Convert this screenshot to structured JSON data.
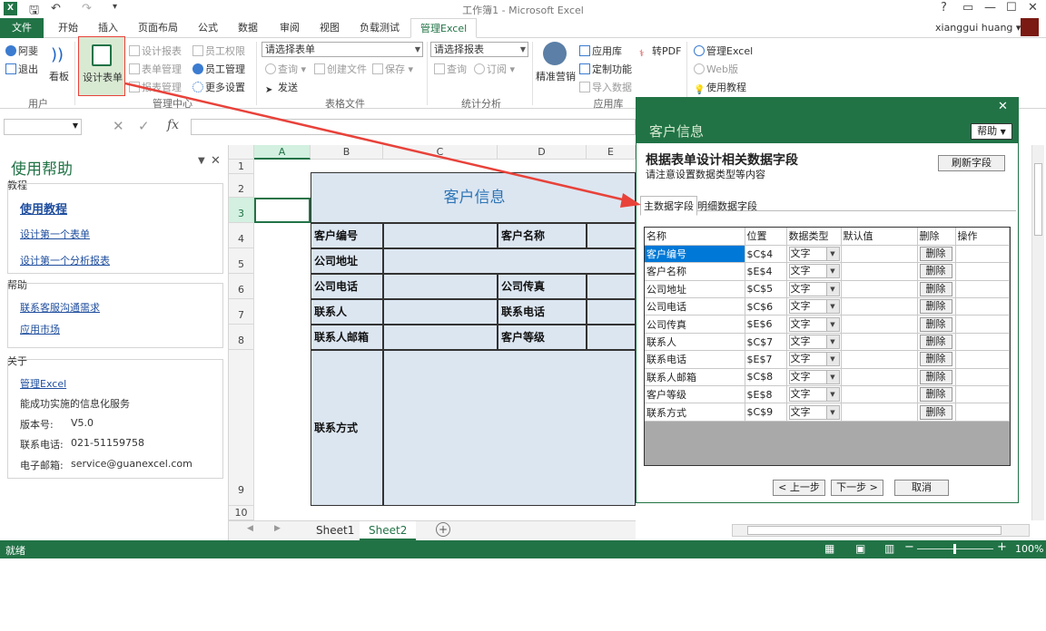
{
  "app": {
    "window_title": "工作簿1 - Microsoft Excel",
    "user_name": "xianggui huang"
  },
  "tabs": [
    "文件",
    "开始",
    "插入",
    "页面布局",
    "公式",
    "数据",
    "审阅",
    "视图",
    "负载测试",
    "管理Excel"
  ],
  "ribbon": {
    "user": {
      "login": "阿斐",
      "logout": "退出",
      "board": "看板",
      "group_label": "用户"
    },
    "design": {
      "design_form": "设计表单",
      "design_report": "设计报表",
      "form_manage": "表单管理",
      "report_manage": "报表管理",
      "employee_perm": "员工权限",
      "employee_manage": "员工管理",
      "more_settings": "更多设置",
      "group_label": "管理中心"
    },
    "form_file": {
      "select_form": "请选择表单",
      "query": "查询",
      "create_file": "创建文件",
      "save": "保存",
      "send": "发送",
      "group_label": "表格文件"
    },
    "stats": {
      "select_report": "请选择报表",
      "query": "查询",
      "subscribe": "订阅",
      "group_label": "统计分析"
    },
    "apps": {
      "precision": "精准营销",
      "app_store": "应用库",
      "custom": "定制功能",
      "import": "导入数据",
      "to_pdf": "转PDF",
      "group_label": "应用库"
    },
    "manage_excel": {
      "manage": "管理Excel",
      "web": "Web版",
      "tutorial": "使用教程"
    }
  },
  "formula_bar": {
    "fx": "fx"
  },
  "help_pane": {
    "title": "使用帮助",
    "sections": [
      {
        "label": "教程",
        "items": [
          {
            "text": "使用教程",
            "kind": "big-link"
          },
          {
            "text": "设计第一个表单",
            "kind": "link"
          },
          {
            "text": "设计第一个分析报表",
            "kind": "link"
          }
        ]
      },
      {
        "label": "帮助",
        "items": [
          {
            "text": "联系客服沟通需求",
            "kind": "link"
          },
          {
            "text": "应用市场",
            "kind": "link"
          }
        ]
      },
      {
        "label": "关于",
        "items": [
          {
            "text": "管理Excel",
            "kind": "link"
          },
          {
            "text": "能成功实施的信息化服务",
            "kind": "text"
          },
          {
            "label": "版本号:",
            "value": "V5.0",
            "kind": "pair"
          },
          {
            "label": "联系电话:",
            "value": "021-51159758",
            "kind": "pair"
          },
          {
            "label": "电子邮箱:",
            "value": "service@guanexcel.com",
            "kind": "pair"
          }
        ]
      }
    ]
  },
  "sheet": {
    "columns": [
      "A",
      "B",
      "C",
      "D",
      "E"
    ],
    "rows": [
      "1",
      "2",
      "3",
      "4",
      "5",
      "6",
      "7",
      "8",
      "9",
      "10"
    ],
    "form_title": "客户信息",
    "labels": {
      "customer_no": "客户编号",
      "customer_name": "客户名称",
      "address": "公司地址",
      "phone": "公司电话",
      "fax": "公司传真",
      "contact": "联系人",
      "contact_phone": "联系电话",
      "contact_email": "联系人邮箱",
      "level": "客户等级",
      "contact_method": "联系方式"
    },
    "tabs": [
      "Sheet1",
      "Sheet2"
    ],
    "active_tab": "Sheet2"
  },
  "status": {
    "text": "就绪",
    "zoom": "100%"
  },
  "dialog": {
    "title": "客户信息",
    "help_label": "帮助",
    "heading": "根据表单设计相关数据字段",
    "subheading": "请注意设置数据类型等内容",
    "refresh_button": "刷新字段",
    "tabs": [
      "主数据字段",
      "明细数据字段"
    ],
    "columns": [
      "名称",
      "位置",
      "数据类型",
      "默认值",
      "删除",
      "操作"
    ],
    "rows": [
      {
        "name": "客户编号",
        "pos": "$C$4",
        "type": "文字",
        "del": "删除"
      },
      {
        "name": "客户名称",
        "pos": "$E$4",
        "type": "文字",
        "del": "删除"
      },
      {
        "name": "公司地址",
        "pos": "$C$5",
        "type": "文字",
        "del": "删除"
      },
      {
        "name": "公司电话",
        "pos": "$C$6",
        "type": "文字",
        "del": "删除"
      },
      {
        "name": "公司传真",
        "pos": "$E$6",
        "type": "文字",
        "del": "删除"
      },
      {
        "name": "联系人",
        "pos": "$C$7",
        "type": "文字",
        "del": "删除"
      },
      {
        "name": "联系电话",
        "pos": "$E$7",
        "type": "文字",
        "del": "删除"
      },
      {
        "name": "联系人邮箱",
        "pos": "$C$8",
        "type": "文字",
        "del": "删除"
      },
      {
        "name": "客户等级",
        "pos": "$E$8",
        "type": "文字",
        "del": "删除"
      },
      {
        "name": "联系方式",
        "pos": "$C$9",
        "type": "文字",
        "del": "删除"
      }
    ],
    "prev_button": "< 上一步",
    "next_button": "下一步 >",
    "cancel_button": "取消"
  },
  "colors": {
    "accent": "#217346",
    "arrow": "#e8423a",
    "form_fill": "#dce6f1",
    "selection": "#0078d7"
  }
}
